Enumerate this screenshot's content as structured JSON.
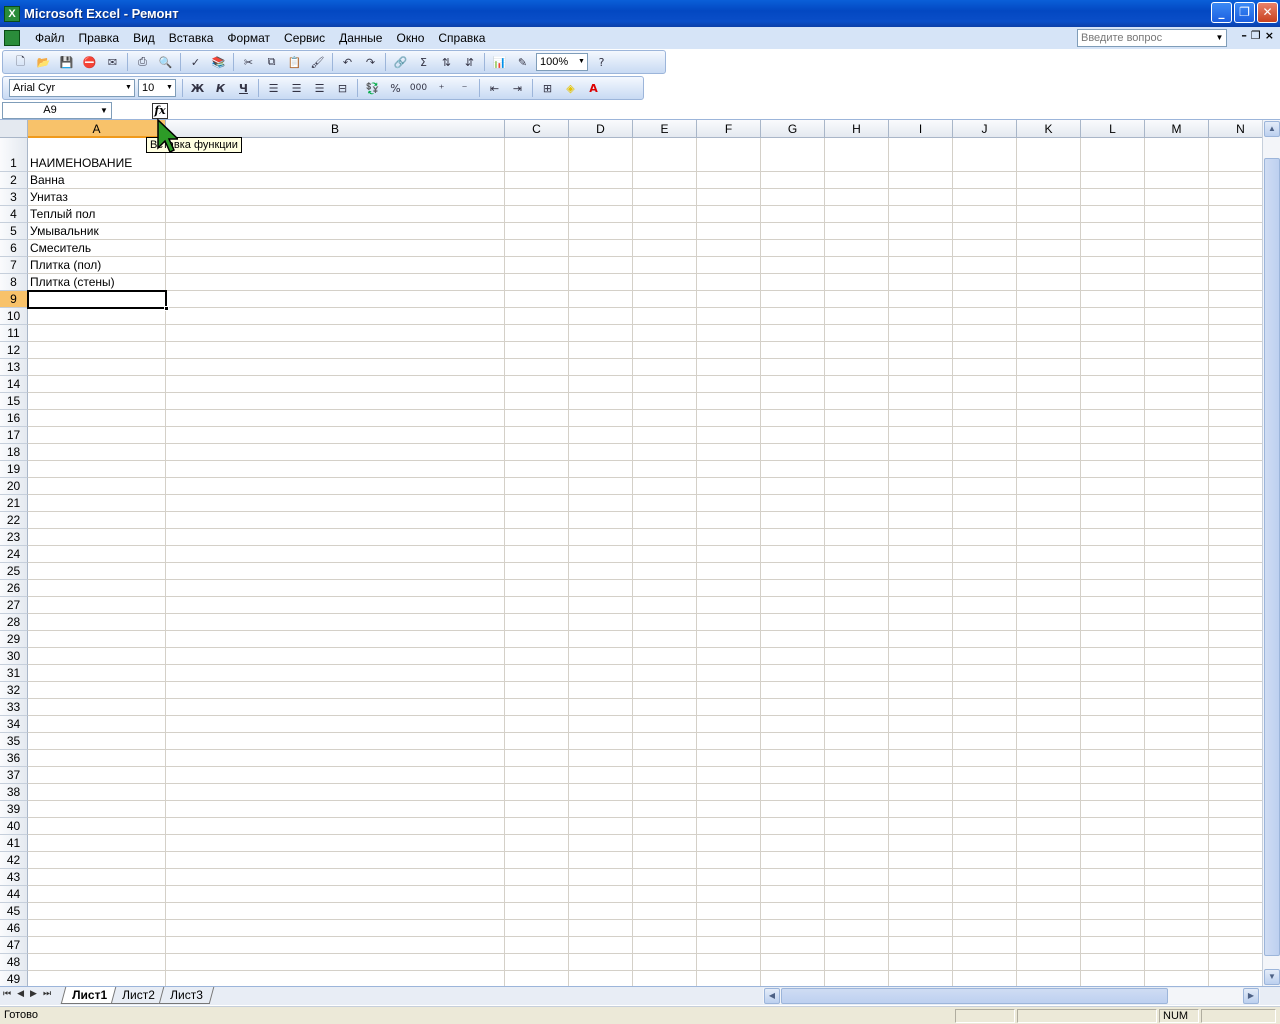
{
  "window": {
    "title": "Microsoft Excel - Ремонт",
    "app_icon": "excel-icon",
    "buttons": [
      "minimize",
      "restore",
      "close"
    ]
  },
  "menu": {
    "items": [
      "Файл",
      "Правка",
      "Вид",
      "Вставка",
      "Формат",
      "Сервис",
      "Данные",
      "Окно",
      "Справка"
    ],
    "help_placeholder": "Введите вопрос"
  },
  "toolbar": {
    "zoom": "100%",
    "font_name": "Arial Cyr",
    "font_size": "10",
    "bold_label": "Ж",
    "italic_label": "К",
    "underline_label": "Ч",
    "percent_label": "%",
    "thousands_label": "000",
    "sum_label": "Σ"
  },
  "formula_bar": {
    "name_box": "A9",
    "fx_label": "fx",
    "formula": "",
    "tooltip": "Вставка функции"
  },
  "sheet": {
    "columns": [
      "A",
      "B",
      "C",
      "D",
      "E",
      "F",
      "G",
      "H",
      "I",
      "J",
      "K",
      "L",
      "M",
      "N"
    ],
    "selected_column": "A",
    "rows": [
      "1",
      "2",
      "3",
      "4",
      "5",
      "6",
      "7",
      "8",
      "9",
      "10",
      "11",
      "12",
      "13",
      "14",
      "15",
      "16",
      "17",
      "18",
      "19",
      "20",
      "21",
      "22",
      "23",
      "24",
      "25",
      "26",
      "27",
      "28",
      "29",
      "30",
      "31",
      "32",
      "33",
      "34",
      "35",
      "36",
      "37",
      "38",
      "39",
      "40",
      "41",
      "42",
      "43",
      "44",
      "45",
      "46",
      "47",
      "48",
      "49"
    ],
    "selected_row": "9",
    "cells": [
      "НАИМЕНОВАНИЕ",
      "Ванна",
      "Унитаз",
      "Теплый пол",
      "Умывальник",
      "Смеситель",
      "Плитка (пол)",
      "Плитка (стены)"
    ]
  },
  "tabs": [
    "Лист1",
    "Лист2",
    "Лист3"
  ],
  "active_tab": "Лист1",
  "status": {
    "text": "Готово",
    "num": "NUM"
  },
  "colors": {
    "titlebar": "#0348c2",
    "menubar": "#d6e4f7",
    "selection_header": "#f8c26a",
    "gridline": "#d4d0c8"
  }
}
